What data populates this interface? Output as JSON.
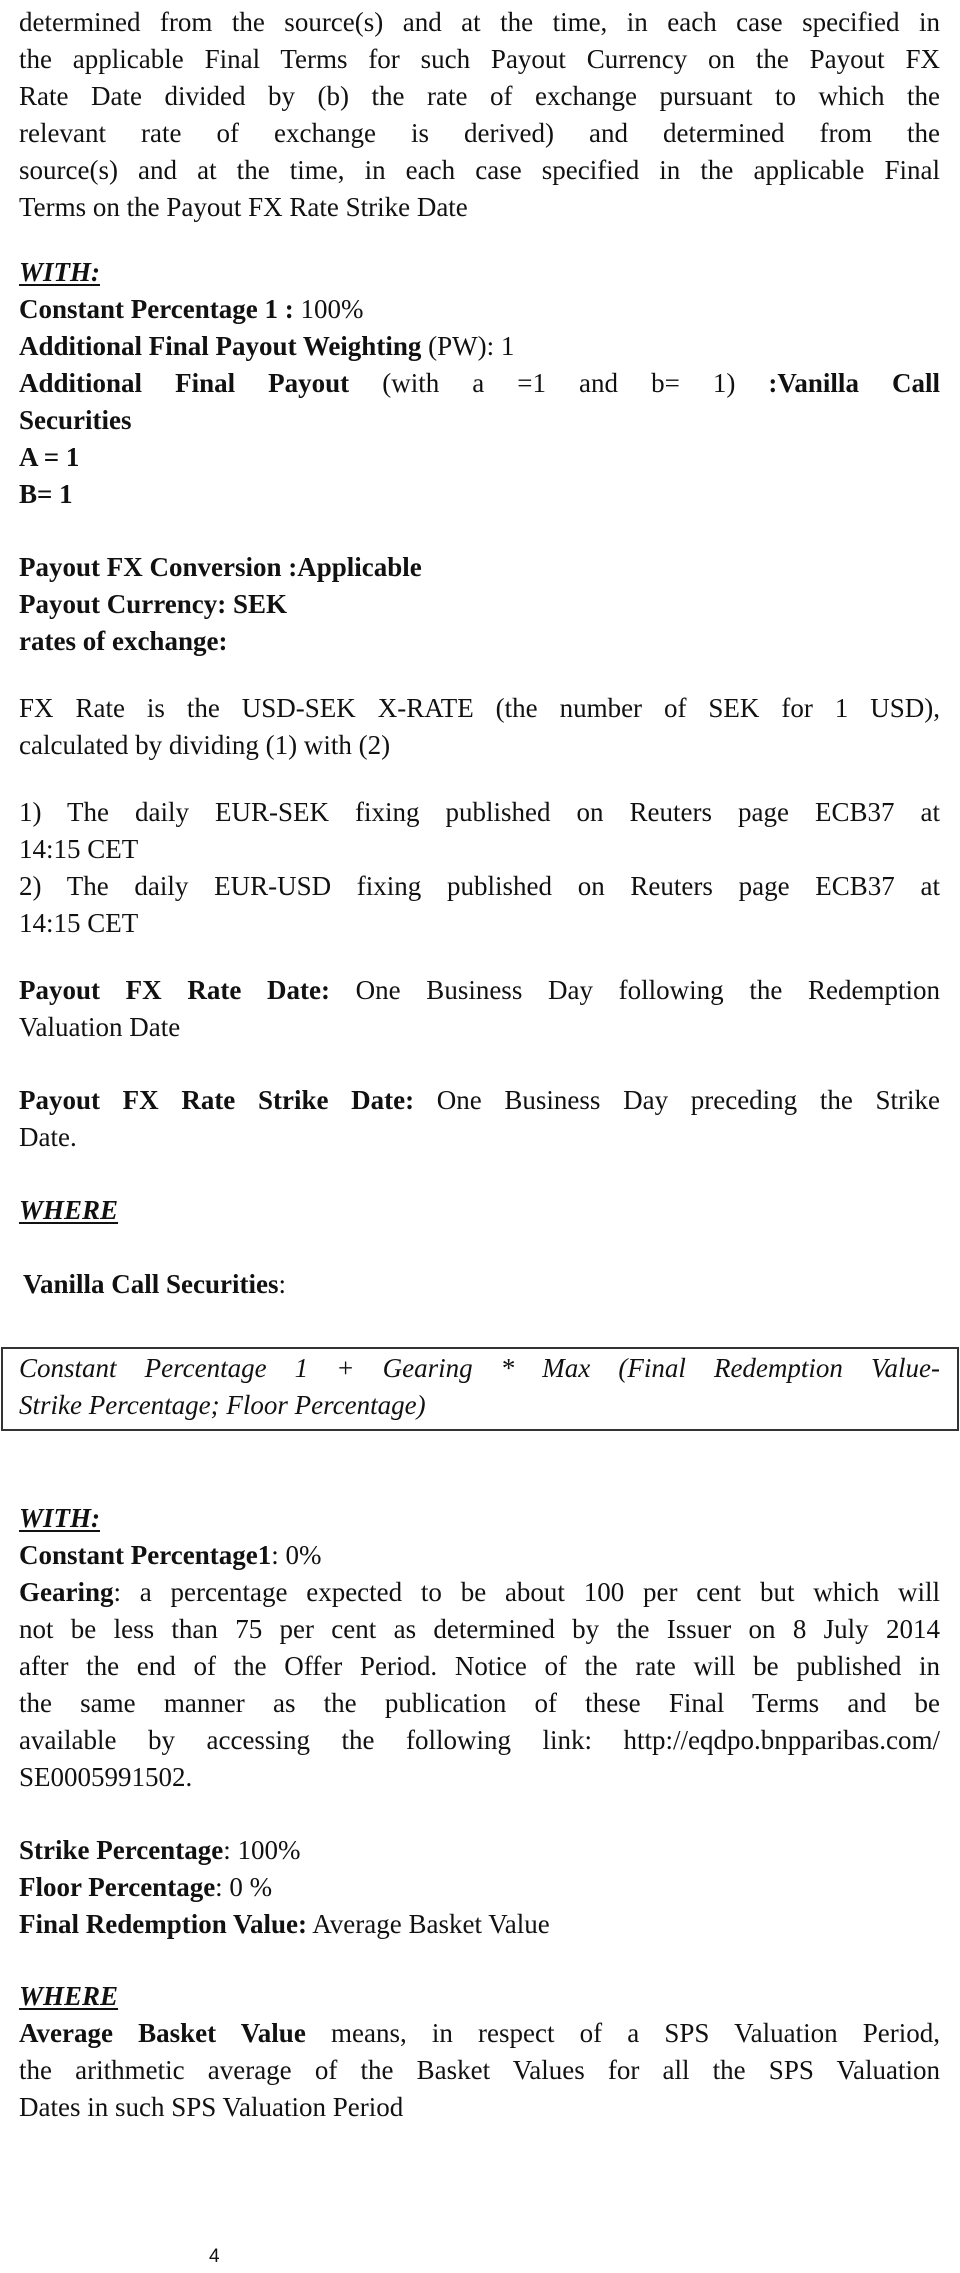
{
  "intro": {
    "lines": [
      "determined from the source(s) and at the time, in each case specified in",
      "the applicable Final Terms for such Payout Currency on the Payout FX",
      "Rate Date divided by (b) the rate of exchange pursuant to which the",
      "relevant rate  of exchange is derived) and determined from the",
      "source(s) and at the time, in each case specified  in the applicable Final",
      "Terms on the Payout FX Rate Strike Date"
    ]
  },
  "with1": {
    "heading": "WITH:",
    "constant_pct_label": "Constant Percentage 1 :",
    "constant_pct_value": " 100%",
    "pw_label": "Additional Final Payout Weighting",
    "pw_value": " (PW): 1",
    "afp_label": "Additional Final Payout",
    "afp_params": " (with a =1 and b= 1) ",
    "afp_value": ":Vanilla Call",
    "afp_value_cont": "Securities",
    "a_line": "A = 1",
    "b_line": "B= 1"
  },
  "fx": {
    "conversion": "Payout FX Conversion :Applicable",
    "currency": "Payout Currency: SEK",
    "rates_heading": "rates of exchange:",
    "rate_desc": [
      "FX Rate is the USD-SEK X-RATE (the number of SEK for 1 USD),",
      "calculated  by dividing (1) with (2)"
    ],
    "source1": [
      "1) The daily EUR-SEK fixing published on Reuters page ECB37 at",
      "14:15 CET"
    ],
    "source2": [
      "2) The daily EUR-USD fixing published on Reuters page  ECB37 at",
      "14:15 CET"
    ],
    "rate_date_label": "Payout FX Rate Date:",
    "rate_date_value": " One Business Day following the Redemption",
    "rate_date_value_cont": "Valuation Date",
    "strike_date_label": "Payout FX Rate Strike Date:",
    "strike_date_value": " One Business Day preceding the Strike",
    "strike_date_value_cont": "Date."
  },
  "where1": {
    "heading": "WHERE",
    "vcs_label": "Vanilla Call Securities",
    "vcs_colon": ":",
    "formula": [
      "Constant Percentage 1 + Gearing * Max (Final Redemption Value-",
      "Strike Percentage; Floor Percentage)"
    ]
  },
  "with2": {
    "heading": "WITH:",
    "cp_label": "Constant Percentage1",
    "cp_value": ": 0%",
    "gearing_label": "Gearing",
    "gearing_lines": [
      ": a percentage expected to be about 100 per cent but which will",
      "not be less than 75 per cent as determined by the Issuer on 8 July 2014",
      "after the end of the Offer Period. Notice of the rate will be published in",
      "the same manner as the publication of these Final Terms and be",
      "available by accessing the following link: http://eqdpo.bnpparibas.com/",
      "SE0005991502."
    ],
    "strike_label": "Strike Percentage",
    "strike_value": ": 100%",
    "floor_label": "Floor Percentage",
    "floor_value": ": 0 %",
    "frv_label": "Final Redemption Value:",
    "frv_value": " Average Basket Value"
  },
  "where2": {
    "heading": "WHERE",
    "abv_label": "Average Basket Value",
    "abv_lines": [
      " means, in respect of a SPS Valuation Period,",
      "the arithmetic average of the Basket Values for all the SPS Valuation",
      "Dates in such SPS Valuation Period"
    ]
  },
  "footer": {
    "page_number": "4"
  }
}
